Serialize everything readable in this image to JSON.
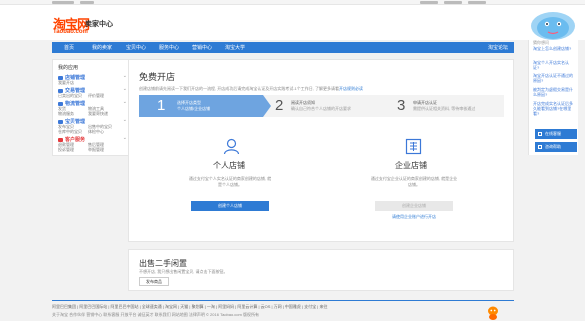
{
  "header": {
    "logo_cn": "淘宝网",
    "logo_en": "Taobao.com",
    "title": "卖家中心"
  },
  "nav": {
    "items": [
      "首页",
      "我的卖家",
      "宝贝中心",
      "服务中心",
      "营销中心",
      "淘宝大学"
    ],
    "right": "淘宝论坛"
  },
  "sidebar": {
    "title": "我的应用",
    "sections": [
      {
        "head": "店铺管理",
        "lines": [
          [
            "我要开店",
            ""
          ]
        ]
      },
      {
        "head": "交易管理",
        "lines": [
          [
            "已卖出的宝贝",
            "评价管理"
          ]
        ]
      },
      {
        "head": "物流管理",
        "lines": [
          [
            "发货",
            "物流工具"
          ],
          [
            "物流服务",
            "我要寄快递"
          ]
        ]
      },
      {
        "head": "宝贝管理",
        "lines": [
          [
            "发布宝贝",
            "出售中的宝贝"
          ],
          [
            "仓库中的宝贝",
            "体检中心"
          ]
        ]
      },
      {
        "head": "客户服务",
        "lines": [
          [
            "退款管理",
            "售后管理"
          ],
          [
            "投诉管理",
            "举报管理"
          ]
        ]
      }
    ]
  },
  "main": {
    "title": "免费开店",
    "desc": "创建店铺前请先阅读一下我们开店的一流程, 开店成功后请完成淘宝认证及开店实践考试-1个工作日, 了解更多请看",
    "desc_link": "开店规则必读",
    "steps": [
      {
        "num": "1",
        "title": "选择开店类型",
        "sub": "个人店铺/企业店铺"
      },
      {
        "num": "2",
        "title": "阅读开店须知",
        "sub": "确认自己符合个人店铺的开店要求"
      },
      {
        "num": "3",
        "title": "申请开店认证",
        "sub": "需提供认证相关资料, 等待审核通过"
      }
    ],
    "personal": {
      "title": "个人店铺",
      "desc": "通过支付宝个人实名认证的商家创建的店铺, 就是个人店铺。",
      "button": "创建个人店铺"
    },
    "enterprise": {
      "title": "企业店铺",
      "desc": "通过支付宝企业认证的商家创建的店铺, 就是企业店铺。",
      "button": "创建企业店铺",
      "link": "请使用企业账户进行开店"
    }
  },
  "second": {
    "title": "出售二手闲置",
    "desc": "不想开店, 我只想出售闲置宝贝, 请点击下面按钮。",
    "button": "发布商品"
  },
  "footer": {
    "line1": "阿里巴巴集团 | 阿里巴巴国际站 | 阿里巴巴中国站 | 全球速卖通 | 淘宝网 | 天猫 | 聚划算 | 一淘 | 阿里妈妈 | 阿里云计算 | 云OS | 万网 | 中国雅虎 | 支付宝 | 来往",
    "line2": "关于淘宝 合作伙伴 营销中心 联系客服 开放平台 诚征英才 联系我们 网站地图 法律声明    © 2016 Taobao.com 版权所有"
  },
  "right_panel": {
    "head": "猜你想问",
    "items": [
      "淘宝上怎么创建店铺?",
      "淘宝个人开店实名认证?",
      "淘宝开店认证不通过的原因?",
      "被判定为虚假交易是什么原因?",
      "开店完成实名认证后多久能看到店铺?在哪里看?"
    ],
    "buttons": [
      "在线客服",
      "咨询帮助"
    ]
  },
  "colors": {
    "brand_orange": "#ff4400",
    "nav_blue": "#2e7bd4",
    "step_active": "#6ea4e0",
    "link_blue": "#3c78d8"
  }
}
